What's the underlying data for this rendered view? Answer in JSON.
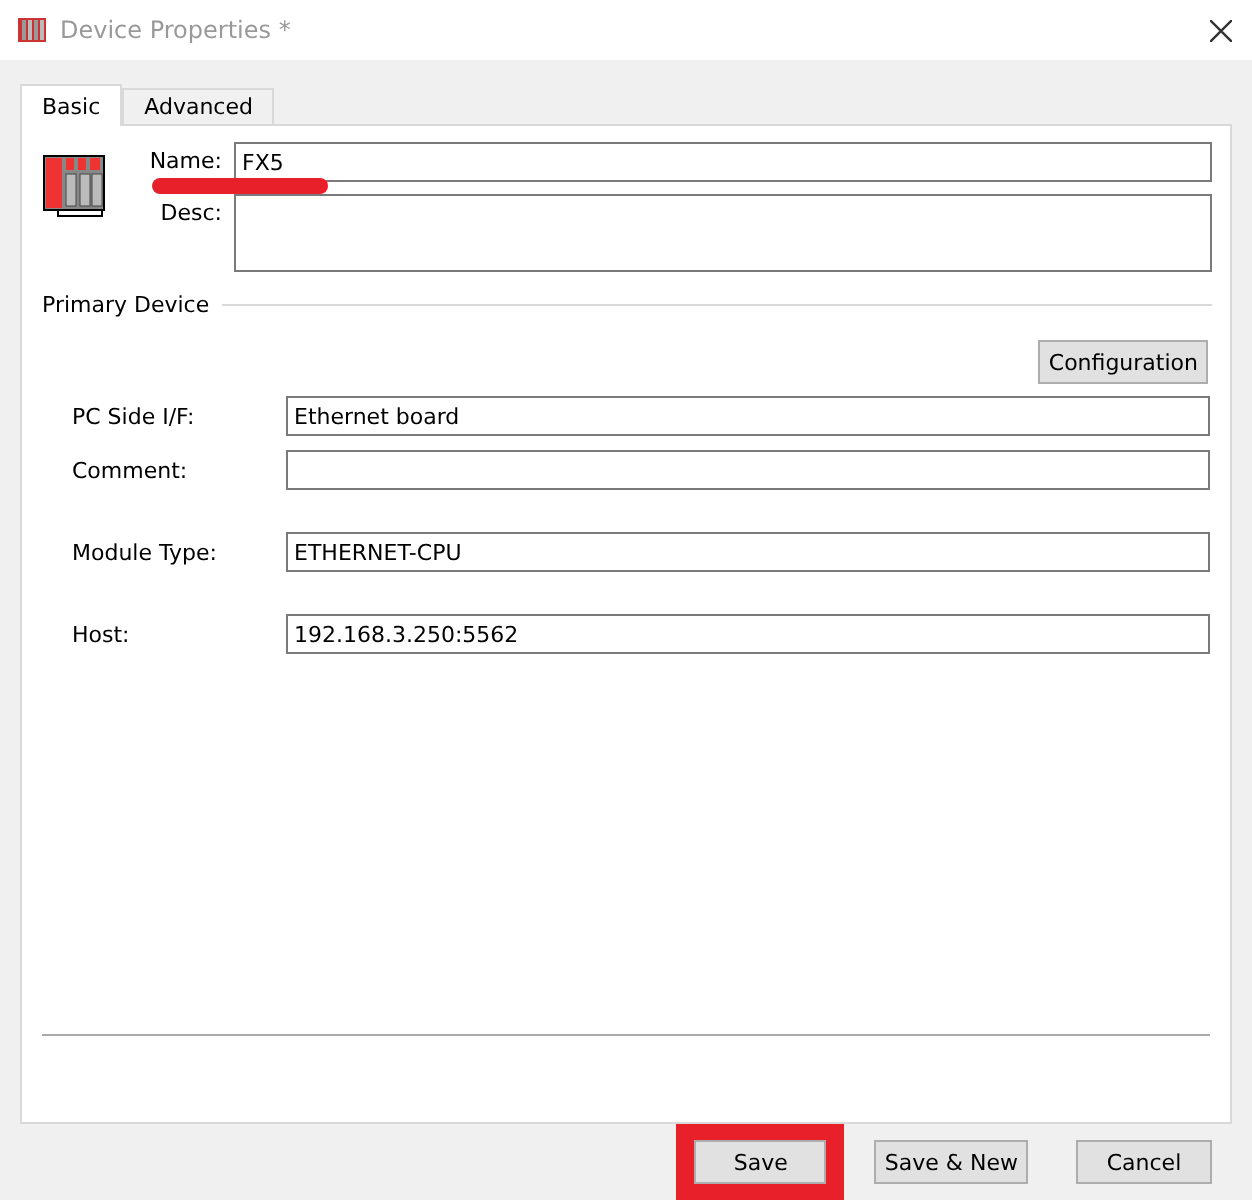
{
  "window": {
    "title": "Device Properties *"
  },
  "tabs": [
    {
      "label": "Basic",
      "selected": true
    },
    {
      "label": "Advanced",
      "selected": false
    }
  ],
  "device": {
    "name_label": "Name:",
    "name_value": "FX5",
    "desc_label": "Desc:"
  },
  "primary_device": {
    "title": "Primary Device",
    "configuration_button": "Configuration",
    "fields": [
      {
        "label": "PC Side I/F:",
        "value": "Ethernet board"
      },
      {
        "label": "Comment:"
      },
      {
        "label": "Module Type:",
        "value": "ETHERNET-CPU"
      },
      {
        "label": "Host:",
        "value": "192.168.3.250:5562"
      }
    ]
  },
  "buttons": [
    {
      "label": "Save",
      "highlighted": true
    },
    {
      "label": "Save & New",
      "highlighted": false
    },
    {
      "label": "Cancel",
      "highlighted": false
    }
  ]
}
